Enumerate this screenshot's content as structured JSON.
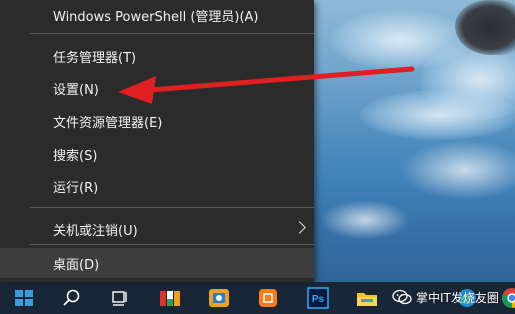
{
  "menu": {
    "items": [
      {
        "label": "Windows PowerShell (管理员)(A)"
      },
      {
        "label": "任务管理器(T)"
      },
      {
        "label": "设置(N)"
      },
      {
        "label": "文件资源管理器(E)"
      },
      {
        "label": "搜索(S)"
      },
      {
        "label": "运行(R)"
      },
      {
        "label": "关机或注销(U)"
      },
      {
        "label": "桌面(D)"
      }
    ]
  },
  "watermark": {
    "text": "掌中IT发烧友圈"
  },
  "colors": {
    "menu_bg": "#2b2b2b",
    "menu_hover": "#3d3d3d",
    "annotation_arrow": "#e02020",
    "taskbar_bg": "#161e28"
  },
  "taskbar": {
    "icons": [
      "windows-start-icon",
      "search-icon",
      "task-view-icon",
      "colorful-app-icon",
      "photo-app-icon",
      "orange-app-icon",
      "photoshop-icon",
      "file-explorer-icon",
      "edge-icon",
      "chrome-icon"
    ],
    "photoshop_label": "Ps"
  }
}
